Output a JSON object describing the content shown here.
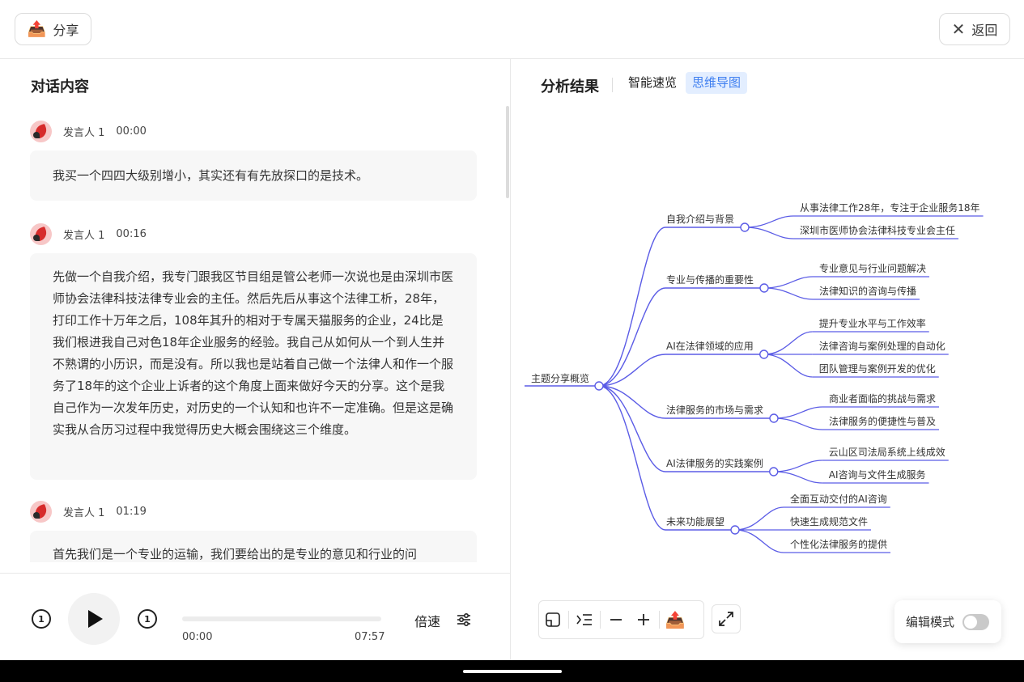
{
  "topbar": {
    "share_label": "分享",
    "back_label": "返回"
  },
  "transcript": {
    "title": "对话内容",
    "messages": [
      {
        "speaker": "发言人 1",
        "time": "00:00",
        "text": "我买一个四四大级别增小，其实还有有先放探口的是技术。"
      },
      {
        "speaker": "发言人 1",
        "time": "00:16",
        "text": "先做一个自我介绍，我专门跟我区节目组是管公老师一次说也是由深圳市医师协会法律科技法律专业会的主任。然后先后从事这个法律工析，28年，打印工作十万年之后，108年其升的相对于专属天猫服务的企业，24比是我们根进我自己对色18年企业服务的经验。我自己从如何从一个到人生并不熟谓的小历识，而是没有。所以我也是站着自己做一个法律人和作一个服务了18年的这个企业上诉者的这个角度上面来做好今天的分享。这个是我自己作为一次发年历史，对历史的一个认知和也许不一定准确。但是这是确实我从合历习过程中我觉得历史大概会围绕这三个维度。"
      },
      {
        "speaker": "发言人 1",
        "time": "01:19",
        "text": "首先我们是一个专业的运输，我们要给出的是专业的意见和行业的问"
      }
    ]
  },
  "player": {
    "current": "00:00",
    "duration": "07:57",
    "progress": 0.0,
    "speed_label": "倍速",
    "skip_back": "1",
    "skip_fwd": "1"
  },
  "analysis": {
    "title": "分析结果",
    "tabs": [
      "智能速览",
      "思维导图"
    ],
    "active_tab": 1,
    "edit_mode_label": "编辑模式",
    "edit_mode_on": false
  },
  "mindmap": {
    "root": "主题分享概览",
    "branches": [
      {
        "label": "自我介绍与背景",
        "children": [
          "从事法律工作28年，专注于企业服务18年",
          "深圳市医师协会法律科技专业会主任"
        ]
      },
      {
        "label": "专业与传播的重要性",
        "children": [
          "专业意见与行业问题解决",
          "法律知识的咨询与传播"
        ]
      },
      {
        "label": "AI在法律领域的应用",
        "children": [
          "提升专业水平与工作效率",
          "法律咨询与案例处理的自动化",
          "团队管理与案例开发的优化"
        ]
      },
      {
        "label": "法律服务的市场与需求",
        "children": [
          "商业者面临的挑战与需求",
          "法律服务的便捷性与普及"
        ]
      },
      {
        "label": "AI法律服务的实践案例",
        "children": [
          "云山区司法局系统上线成效",
          "AI咨询与文件生成服务"
        ]
      },
      {
        "label": "未来功能展望",
        "children": [
          "全面互动交付的AI咨询",
          "快速生成规范文件",
          "个性化法律服务的提供"
        ]
      }
    ]
  },
  "colors": {
    "accent": "#3f7ff0",
    "mindmap_line": "#5b5ce6",
    "tab_active_bg": "#e3eeff"
  },
  "icons": [
    "share-icon",
    "close-icon",
    "skip-back-icon",
    "play-icon",
    "skip-forward-icon",
    "settings-icon",
    "fit-view-icon",
    "indent-icon",
    "zoom-out-icon",
    "zoom-in-icon",
    "export-icon",
    "fullscreen-icon"
  ]
}
